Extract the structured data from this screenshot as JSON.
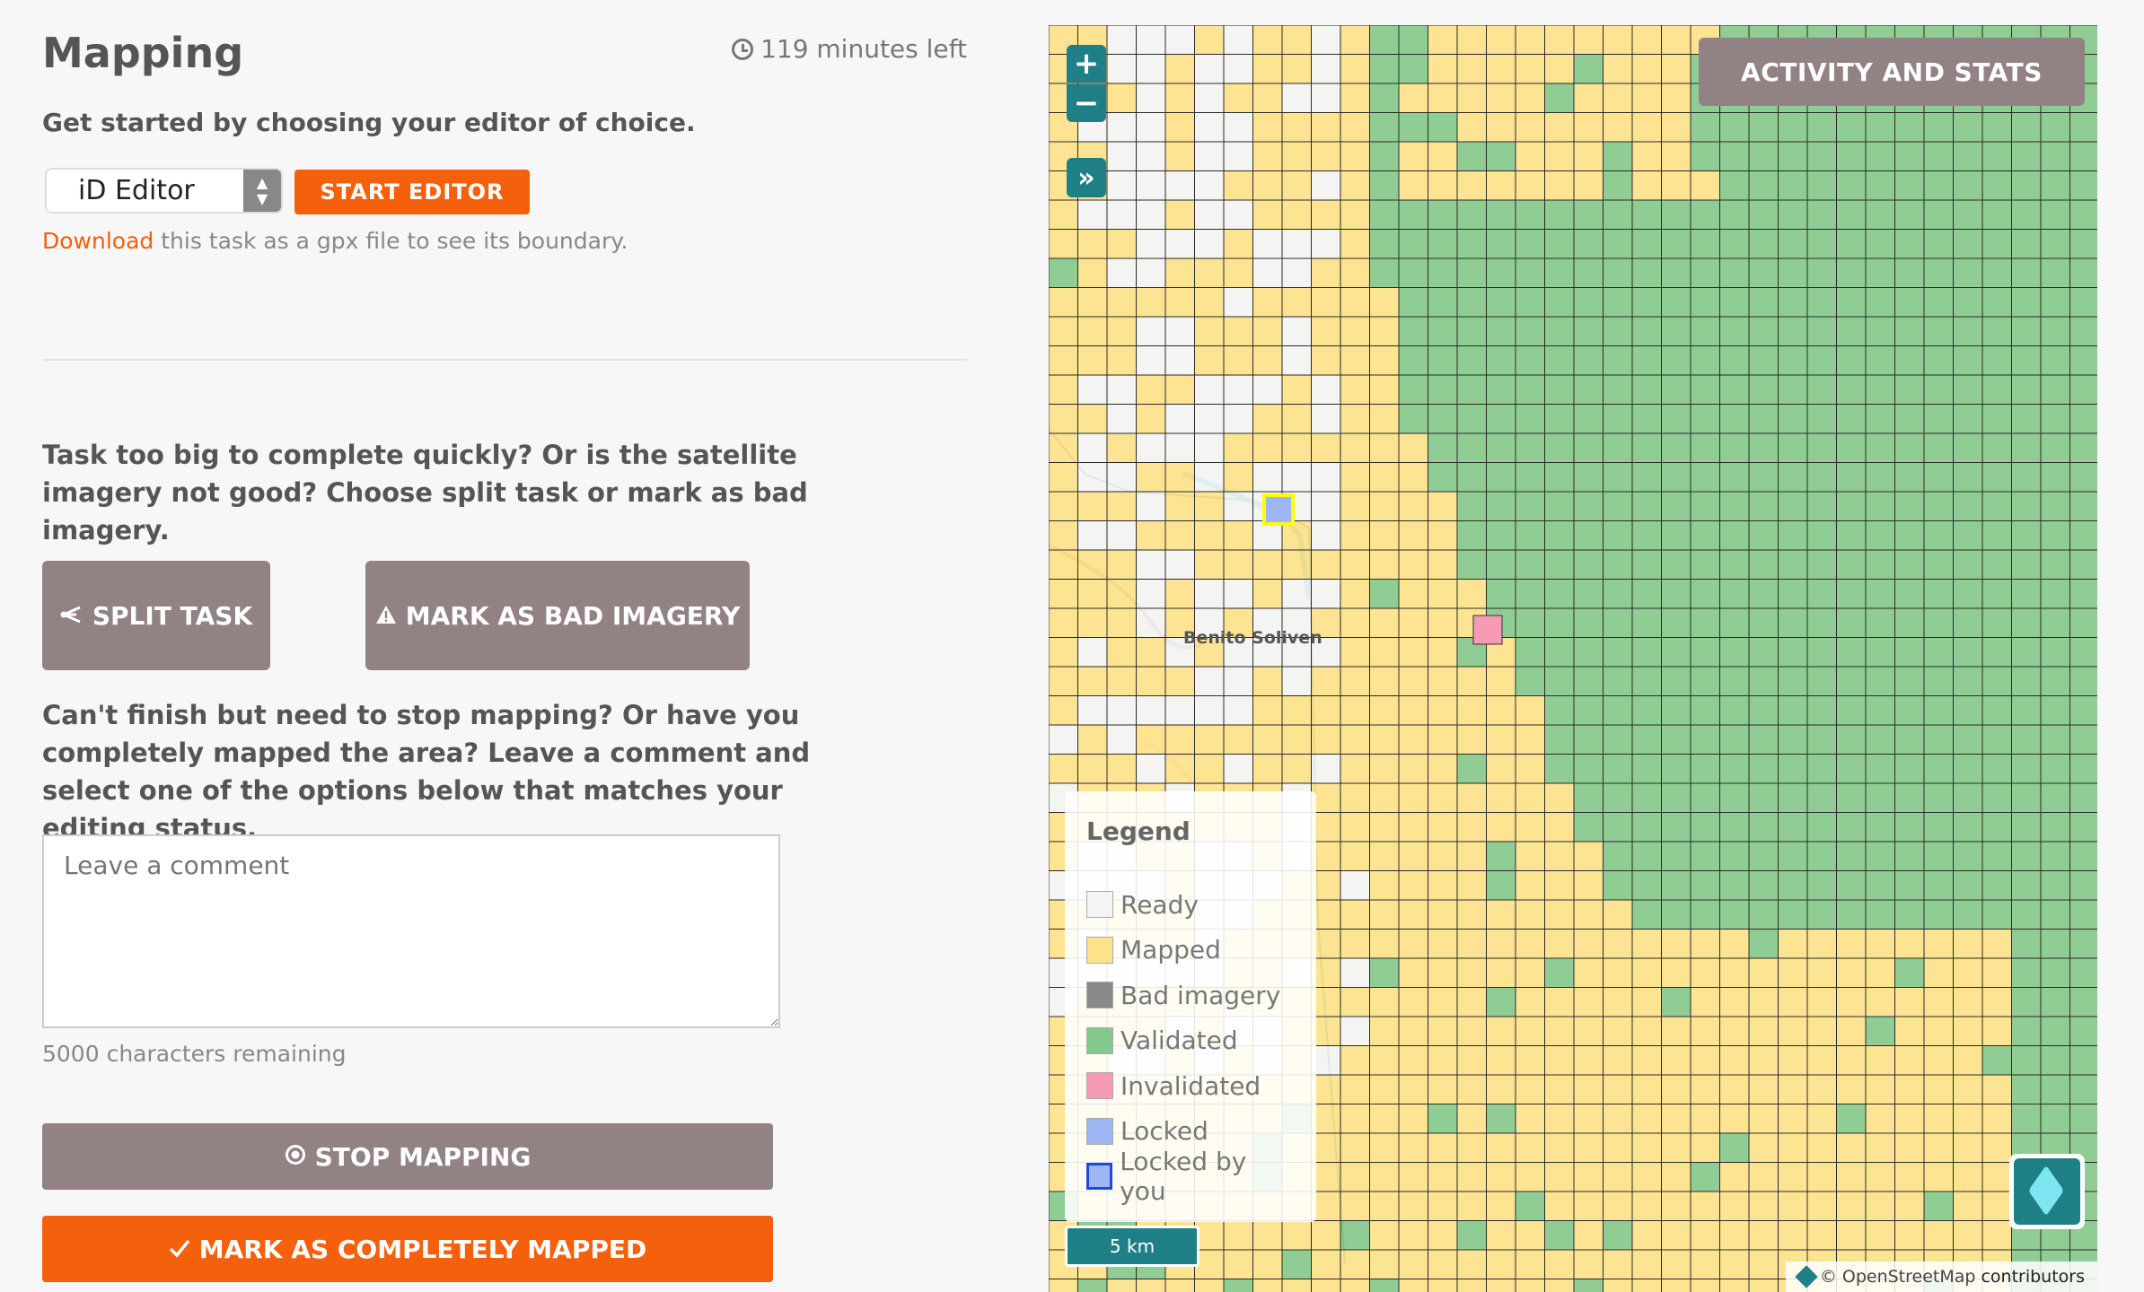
{
  "mapping": {
    "title": "Mapping",
    "time_left": "119 minutes left",
    "choose_editor": "Get started by choosing your editor of choice.",
    "editor_selected": "iD Editor",
    "start_editor": "START EDITOR",
    "download_link": "Download",
    "download_text": " this task as a gpx file to see its boundary.",
    "split_prompt": "Task too big to complete quickly? Or is the satellite imagery not good? Choose split task or mark as bad imagery.",
    "split_button": "SPLIT TASK",
    "bad_imagery_button": "MARK AS BAD IMAGERY",
    "stop_prompt": "Can't finish but need to stop mapping? Or have you completely mapped the area? Leave a comment and select one of the options below that matches your editing status.",
    "comment_placeholder": "Leave a comment",
    "chars_remaining": "5000 characters remaining",
    "stop_button": "STOP MAPPING",
    "complete_button": "MARK AS COMPLETELY MAPPED"
  },
  "map": {
    "zoom_in": "+",
    "zoom_out": "−",
    "expand": "»",
    "activity_button": "ACTIVITY AND STATS",
    "place_label": "Benito Soliven",
    "scale": "5 km",
    "attribution_link": "© OpenStreetMap",
    "attribution_text": " contributors",
    "legend": {
      "title": "Legend",
      "items": [
        {
          "label": "Ready",
          "color": "#f4f4f4"
        },
        {
          "label": "Mapped",
          "color": "#fde289"
        },
        {
          "label": "Bad imagery",
          "color": "#8a8a8a"
        },
        {
          "label": "Validated",
          "color": "#84c98b"
        },
        {
          "label": "Invalidated",
          "color": "#f79ab6"
        },
        {
          "label": "Locked",
          "color": "#9fb6f5"
        },
        {
          "label": "Locked by you",
          "color": "#9fb6f5"
        }
      ]
    }
  },
  "colors": {
    "accent": "#f4600c",
    "button_gray": "#928283",
    "teal": "#1f7f86"
  }
}
